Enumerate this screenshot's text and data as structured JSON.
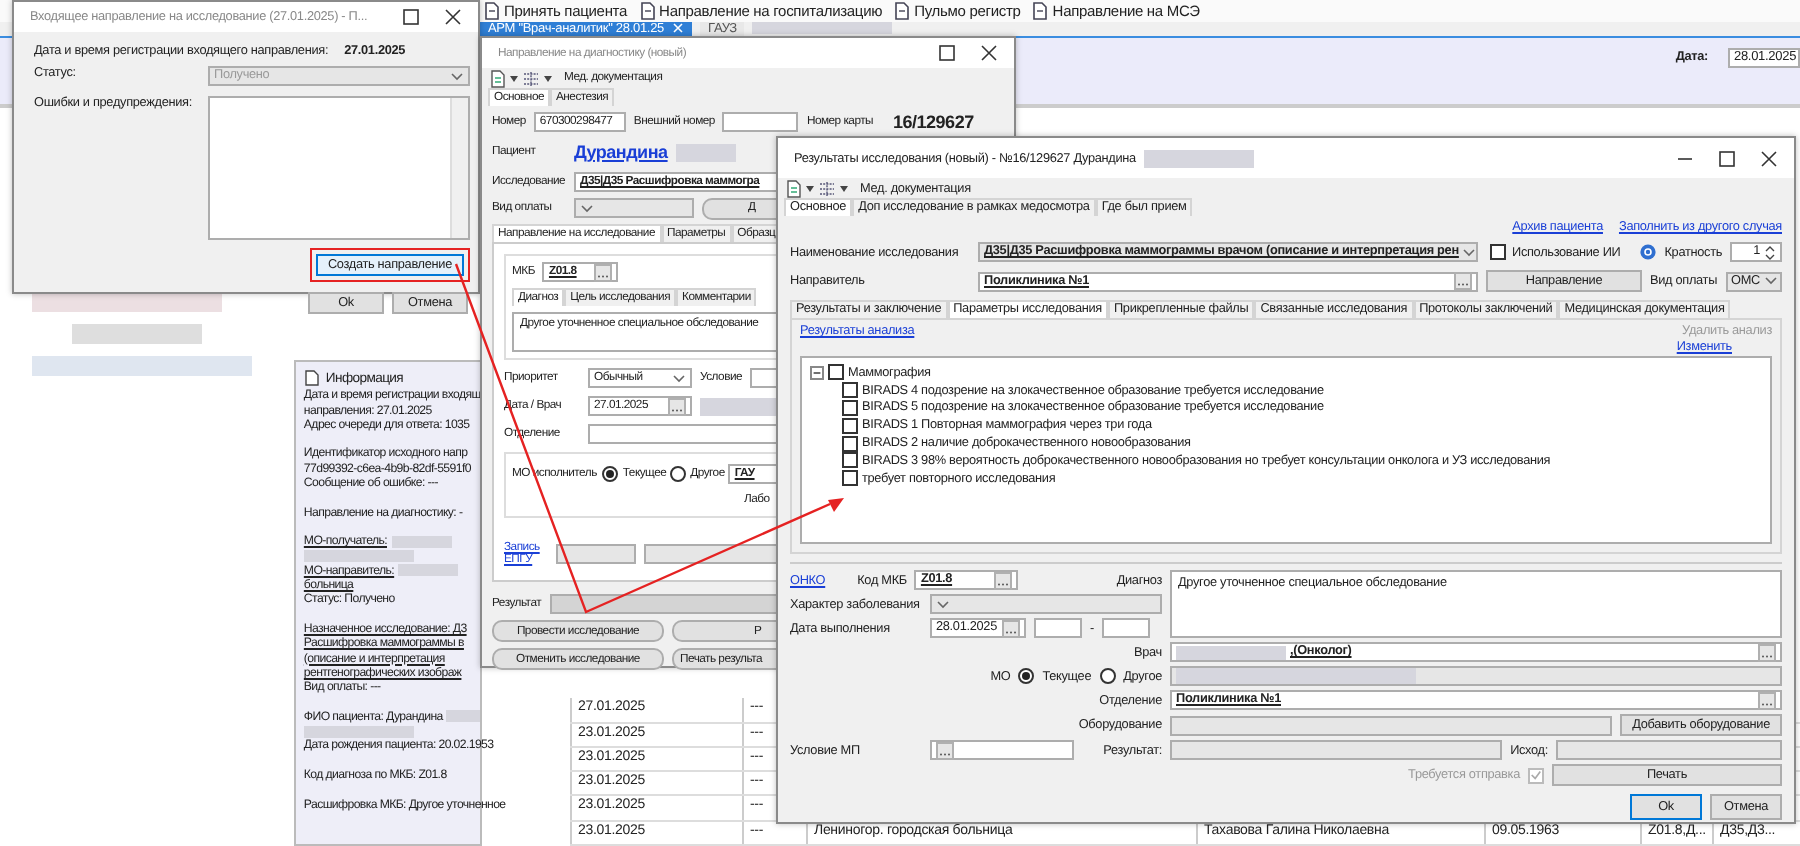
{
  "app": {
    "toolbar": [
      {
        "label": "Принять пациента"
      },
      {
        "label": "Направление на госпитализацию"
      },
      {
        "label": "Пульмо регистр"
      },
      {
        "label": "Направление на МСЭ"
      }
    ],
    "tabs": [
      {
        "label": "АРМ \"Врач-аналитик\" 28.01.25",
        "selected": true,
        "redacted": false
      },
      {
        "label": "ГАУЗ",
        "selected": false,
        "redacted": true
      }
    ],
    "date_label": "Дата:",
    "date_value": "28.01.2025",
    "info_panel": {
      "title": "Информация",
      "lines": [
        {
          "kind": "text",
          "text": "Дата и время регистрации входящ",
          "underlined": false
        },
        {
          "kind": "text",
          "text": "направления: 27.01.2025",
          "underlined": false
        },
        {
          "kind": "text",
          "text": "Адрес очереди для ответа: 1035",
          "underlined": false
        },
        {
          "kind": "gap"
        },
        {
          "kind": "text",
          "text": "Идентификатор исходного напр",
          "underlined": false
        },
        {
          "kind": "text",
          "text": "77d99392-c6ea-4b9b-82df-5591f0",
          "underlined": false
        },
        {
          "kind": "text",
          "text": "Сообщение об ошибке: ---",
          "underlined": false
        },
        {
          "kind": "gap"
        },
        {
          "kind": "text",
          "text": "Направление на диагностику: -",
          "underlined": false
        },
        {
          "kind": "gap"
        },
        {
          "kind": "text_redacted",
          "text": "МО-получатель:",
          "underlined": true
        },
        {
          "kind": "redacted"
        },
        {
          "kind": "text_redacted",
          "text": "МО-направитель:",
          "underlined": true
        },
        {
          "kind": "text",
          "text": "больница",
          "underlined": true
        },
        {
          "kind": "text",
          "text": "Статус: Получено",
          "underlined": false
        },
        {
          "kind": "gap"
        },
        {
          "kind": "text",
          "text": "Назначенное исследование: Д3",
          "underlined": true
        },
        {
          "kind": "text",
          "text": "Расшифровка маммограммы в",
          "underlined": true
        },
        {
          "kind": "text",
          "text": "(описание и интерпретация",
          "underlined": true
        },
        {
          "kind": "text",
          "text": "рентгенографических изображ",
          "underlined": true
        },
        {
          "kind": "text",
          "text": "Вид оплаты: ---",
          "underlined": false
        },
        {
          "kind": "gap"
        },
        {
          "kind": "text_redacted",
          "text": "ФИО пациента: Дурандина",
          "underlined": false
        },
        {
          "kind": "redacted"
        },
        {
          "kind": "text",
          "text": "Дата рождения пациента: 20.02.1953",
          "underlined": false
        },
        {
          "kind": "gap"
        },
        {
          "kind": "text",
          "text": "Код диагноза по МКБ: Z01.8",
          "underlined": false
        },
        {
          "kind": "gap"
        },
        {
          "kind": "text",
          "text": "Расшифровка МКБ: Другое уточненное",
          "underlined": false
        }
      ]
    },
    "table": {
      "rows": [
        {
          "cells": [
            "27.01.2025",
            "---"
          ]
        },
        {
          "cells": [
            "23.01.2025",
            "---"
          ]
        },
        {
          "cells": [
            "23.01.2025",
            "---"
          ]
        },
        {
          "cells": [
            "23.01.2025",
            "---"
          ]
        },
        {
          "cells": [
            "23.01.2025",
            "---"
          ]
        },
        {
          "cells": [
            "23.01.2025",
            "---",
            "Лениногор. городская больница",
            "Тахавова Галина Николаевна",
            "09.05.1963",
            "Z01.8,Д...",
            "Д35,Д3..."
          ]
        }
      ]
    }
  },
  "incoming_window": {
    "title": "Входящее направление на исследование (27.01.2025) - П...",
    "reg_label": "Дата и время регистрации входящего направления:",
    "reg_value": "27.01.2025",
    "status_label": "Статус:",
    "status_value": "Получено",
    "errors_label": "Ошибки и предупреждения:",
    "buttons": [
      {
        "label": "Создать направление",
        "highlighted": true
      },
      {
        "label": "Ok",
        "highlighted": false
      },
      {
        "label": "Отмена",
        "highlighted": false
      }
    ]
  },
  "diagnostics_window": {
    "title": "Направление на диагностику (новый)",
    "toolbar_label": "Мед. документация",
    "tabs": [
      {
        "label": "Основное",
        "selected": true
      },
      {
        "label": "Анестезия",
        "selected": false
      }
    ],
    "number_label": "Номер",
    "number_value": "670300298477",
    "external_label": "Внешний номер",
    "card_label": "Номер карты",
    "card_value": "16/129627",
    "patient_label": "Пациент",
    "patient_name": "Дурандина",
    "study_label": "Исследование",
    "study_value": "Д35|Д35 Расшифровка маммогра",
    "payment_label": "Вид оплаты",
    "side_button": "Д",
    "section_tabs": [
      {
        "label": "Направление на исследование",
        "selected": true
      },
      {
        "label": "Параметры",
        "selected": false
      },
      {
        "label": "Образц",
        "selected": false
      }
    ],
    "mkb_label": "МКБ",
    "mkb_value": "Z01.8",
    "diagnosis_tabs": [
      {
        "label": "Диагноз",
        "selected": true
      },
      {
        "label": "Цель исследования",
        "selected": false
      },
      {
        "label": "Комментарии",
        "selected": false
      }
    ],
    "diagnosis_text": "Другое уточненное специальное обследование",
    "priority_label": "Приоритет",
    "priority_value": "Обычный",
    "condition_label": "Условие",
    "date_label": "Дата / Врач",
    "date_value": "27.01.2025",
    "department_label": "Отделение",
    "mo_label": "МО исполнитель",
    "mo_options": [
      {
        "label": "Текущее",
        "selected": true
      },
      {
        "label": "Другое",
        "selected": false
      }
    ],
    "mo_value": "ГАУ",
    "lab_label": "Лабо",
    "epgu_link": "Запись ЕПГУ",
    "result_label": "Результат",
    "buttons": [
      {
        "label": "Провести исследование"
      },
      {
        "label": "Р"
      },
      {
        "label": "Отменить исследование"
      },
      {
        "label": "Печать результа"
      }
    ]
  },
  "results_window": {
    "title": "Результаты исследования (новый) - №16/129627 Дурандина",
    "toolbar_label": "Мед. документация",
    "tabs": [
      {
        "label": "Основное",
        "selected": true
      },
      {
        "label": "Доп исследование в рамках медосмотра",
        "selected": false
      },
      {
        "label": "Где был прием",
        "selected": false
      }
    ],
    "links": [
      "Архив пациента",
      "Заполнить из другого случая"
    ],
    "study_label": "Наименование исследования",
    "study_value": "Д35|Д35 Расшифровка маммограммы врачом (описание и интерпретация рен",
    "ai": {
      "label": "Использование ИИ",
      "checked": false
    },
    "multiplicity_label": "Кратность",
    "multiplicity_value": "1",
    "referrer_label": "Направитель",
    "referrer_value": "Поликлиника №1",
    "referral_button": "Направление",
    "payment_label": "Вид оплаты",
    "payment_value": "ОМС",
    "section_tabs": [
      {
        "label": "Результаты и заключение",
        "selected": false
      },
      {
        "label": "Параметры исследования",
        "selected": true
      },
      {
        "label": "Прикрепленные файлы",
        "selected": false
      },
      {
        "label": "Связанные исследования",
        "selected": false
      },
      {
        "label": "Протоколы заключений",
        "selected": false
      },
      {
        "label": "Медицинская документация",
        "selected": false
      }
    ],
    "analysis_link": "Результаты анализа",
    "delete_analysis": {
      "label": "Удалить анализ",
      "disabled": true
    },
    "edit_link": "Изменить",
    "tree": [
      {
        "label": "Маммография",
        "checked": false,
        "expanded": true,
        "children": [
          {
            "label": "BIRADS 4 подозрение на злокачественное образование требуется исследование",
            "checked": false
          },
          {
            "label": "BIRADS 5 подозрение на злокачественное образование требуется исследование",
            "checked": false
          },
          {
            "label": "BIRADS 1 Повторная маммография через три года",
            "checked": false
          },
          {
            "label": "BIRADS 2 наличие доброкачественного новообразования",
            "checked": false
          },
          {
            "label": "BIRADS 3 98% вероятность доброкачественного новообразования но требует консультации онколога и УЗ исследования",
            "checked": false
          },
          {
            "label": "требует повторного исследования",
            "checked": false
          }
        ]
      }
    ],
    "onko_link": "ОНКО",
    "mkb_label": "Код МКБ",
    "mkb_value": "Z01.8",
    "diagnosis_label": "Диагноз",
    "diagnosis_value": "Другое уточненное специальное обследование",
    "disease_label": "Характер заболевания",
    "exec_date_label": "Дата выполнения",
    "exec_date_value": "28.01.2025",
    "range_separator": "-",
    "doctor_label": "Врач",
    "doctor_value": ",(Онколог)",
    "mo_label": "МО",
    "mo_options": [
      {
        "label": "Текущее",
        "selected": true
      },
      {
        "label": "Другое",
        "selected": false
      }
    ],
    "department_label": "Отделение",
    "department_value": "Поликлиника №1",
    "equipment_label": "Оборудование",
    "equipment_button": "Добавить оборудование",
    "condition_label": "Условие МП",
    "result_label": "Результат:",
    "outcome_label": "Исход:",
    "send_required": {
      "label": "Требуется отправка",
      "checked": true,
      "disabled": true
    },
    "print_button": "Печать",
    "buttons": [
      "Ok",
      "Отмена"
    ]
  }
}
